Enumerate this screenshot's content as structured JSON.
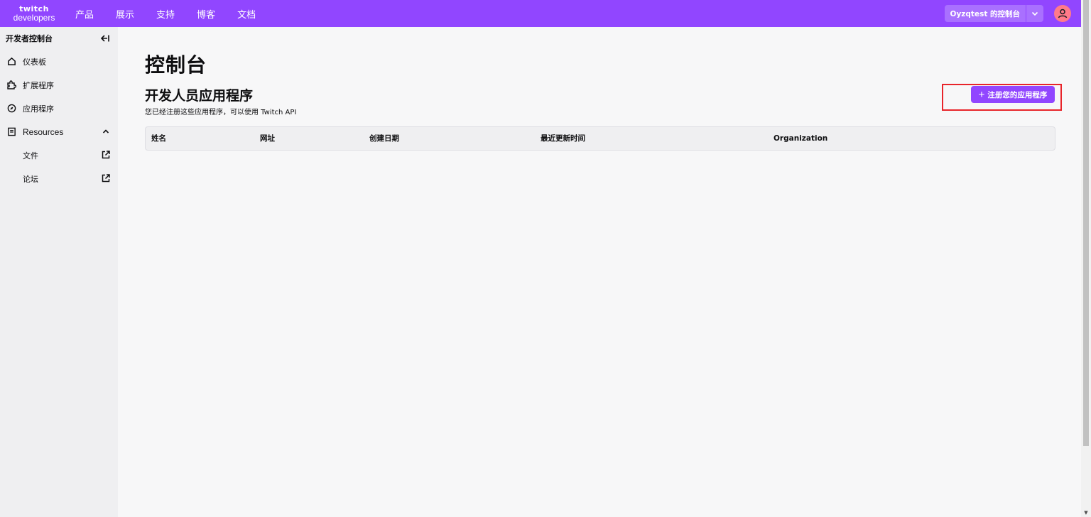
{
  "brand": {
    "wordmark": "twitch",
    "sub": "developers"
  },
  "nav": {
    "items": [
      "产品",
      "展示",
      "支持",
      "博客",
      "文档"
    ]
  },
  "account": {
    "console_label": "Oyzqtest 的控制台"
  },
  "colors": {
    "accent": "#9146ff",
    "highlight": "#e8242a",
    "avatar": "#ff7a8a"
  },
  "sidebar": {
    "title": "开发者控制台",
    "collapse_icon": "collapse-left-icon",
    "items": [
      {
        "label": "仪表板",
        "icon": "home-icon"
      },
      {
        "label": "扩展程序",
        "icon": "puzzle-icon"
      },
      {
        "label": "应用程序",
        "icon": "compass-icon"
      },
      {
        "label": "Resources",
        "icon": "document-icon",
        "expanded": true
      },
      {
        "label": "文件",
        "icon": "external-link-icon"
      },
      {
        "label": "论坛",
        "icon": "external-link-icon"
      }
    ]
  },
  "main": {
    "title": "控制台",
    "section_title": "开发人员应用程序",
    "section_desc": "您已经注册这些应用程序，可以使用 Twitch API",
    "register_button": "注册您的应用程序",
    "table": {
      "columns": [
        "姓名",
        "网址",
        "创建日期",
        "最近更新时间",
        "Organization"
      ]
    }
  }
}
